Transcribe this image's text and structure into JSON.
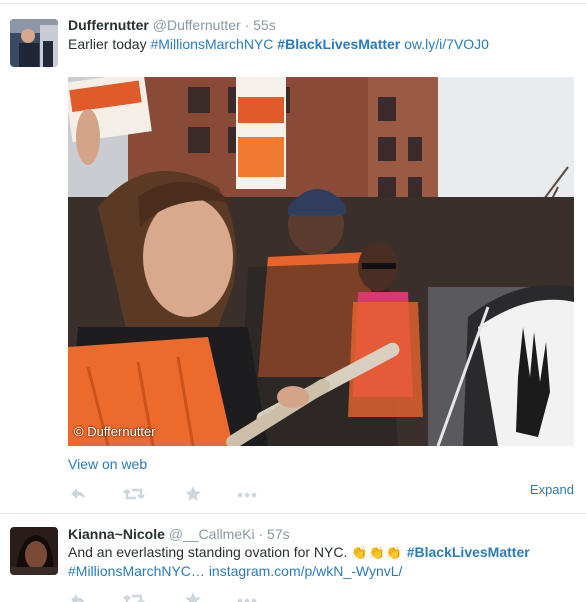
{
  "tweets": [
    {
      "fullname": "Duffernutter",
      "username": "@Duffernutter",
      "separator": "·",
      "timestamp": "55s",
      "text_plain": "Earlier today",
      "hashtag1": "#MillionsMarchNYC",
      "hashtag2": "#BlackLivesMatter",
      "link": "ow.ly/i/7VOJ0",
      "media_credit": "© Duffernutter",
      "view_on_web": "View on web",
      "expand": "Expand"
    },
    {
      "fullname": "Kianna~Nicole",
      "username": "@__CallmeKi",
      "separator": "·",
      "timestamp": "57s",
      "text_plain": "And an everlasting standing ovation for NYC.",
      "emoji": "👏👏👏",
      "hashtag1": "#BlackLivesMatter",
      "hashtag2": "#MillionsMarchNYC…",
      "link": "instagram.com/p/wkN_-WynvL/"
    }
  ],
  "icons": [
    "reply-icon",
    "retweet-icon",
    "favorite-icon",
    "more-icon"
  ],
  "colors": {
    "link": "#2b7bb9",
    "meta": "#8899a6",
    "icon": "#ccd6dd",
    "text": "#292f33"
  }
}
